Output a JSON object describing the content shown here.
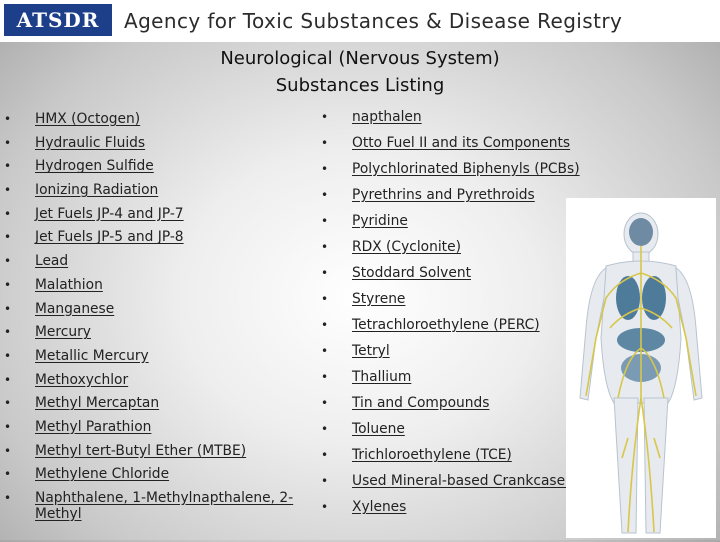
{
  "header": {
    "logo_text": "ATSDR",
    "agency_name": "Agency for Toxic Substances & Disease Registry"
  },
  "title": {
    "line1": "Neurological (Nervous System)",
    "line2": "Substances Listing"
  },
  "left_list": [
    "HMX (Octogen)",
    "Hydraulic Fluids",
    "Hydrogen Sulfide",
    "Ionizing Radiation",
    "Jet Fuels JP-4 and JP-7",
    "Jet Fuels JP-5 and JP-8",
    "Lead",
    "Malathion",
    "Manganese",
    "Mercury",
    "Metallic Mercury",
    "Methoxychlor",
    "Methyl Mercaptan",
    "Methyl Parathion",
    "Methyl tert-Butyl Ether (MTBE)",
    "Methylene Chloride",
    "Naphthalene, 1-Methylnapthalene, 2-Methyl"
  ],
  "right_list": [
    "napthalen",
    "Otto Fuel II and its Components",
    "Polychlorinated Biphenyls (PCBs)",
    "Pyrethrins and Pyrethroids",
    "Pyridine",
    "RDX (Cyclonite)",
    "Stoddard Solvent",
    "Styrene",
    "Tetrachloroethylene (PERC)",
    "Tetryl",
    "Thallium",
    "Tin and Compounds",
    "Toluene",
    "Trichloroethylene (TCE)",
    "Used Mineral-based Crankcase Oil",
    "Xylenes"
  ],
  "colors": {
    "logo_bg": "#1d3f8a",
    "nerve_yellow": "#d8c64a",
    "organ_blue": "#4f7b9a"
  },
  "icons": {
    "bullet": "•",
    "figure": "nervous-system-figure"
  }
}
